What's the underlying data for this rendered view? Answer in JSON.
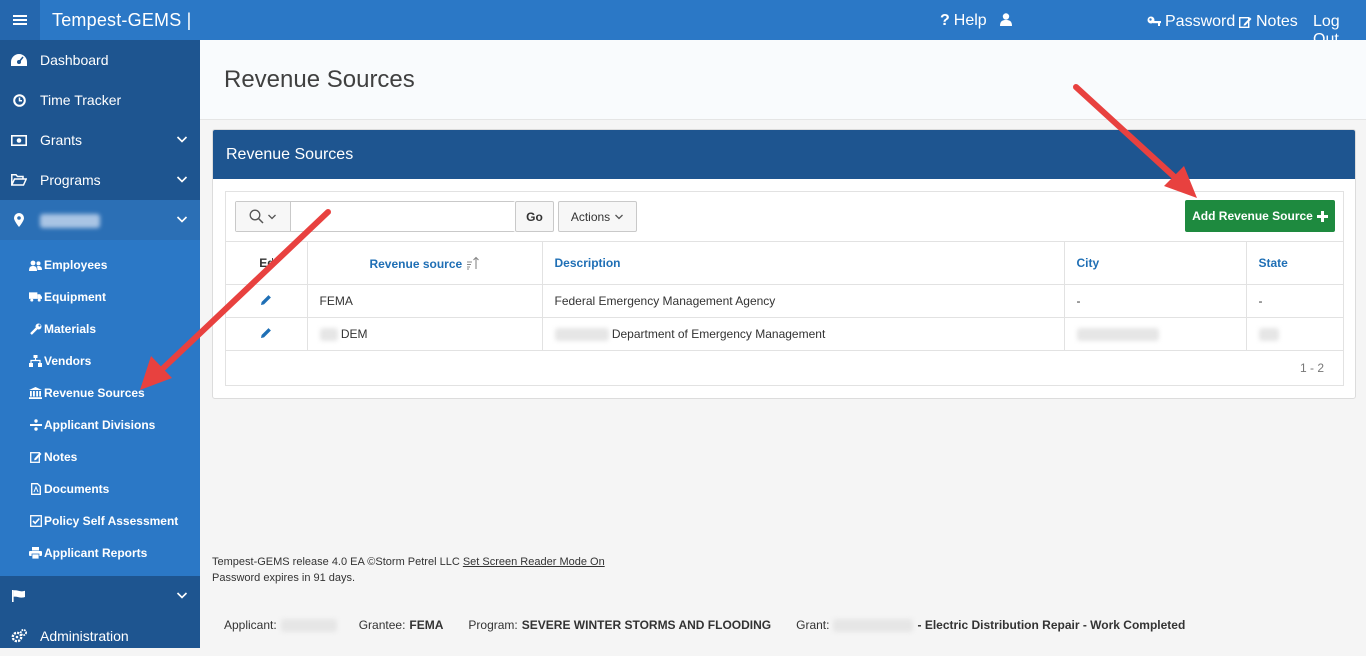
{
  "topbar": {
    "title": "Tempest-GEMS |",
    "help": "Help",
    "password": "Password",
    "notes": "Notes",
    "logout": "Log Out"
  },
  "sidebar": {
    "items": [
      {
        "label": "Dashboard",
        "icon": "dashboard-icon"
      },
      {
        "label": "Time Tracker",
        "icon": "clock-icon"
      },
      {
        "label": "Grants",
        "icon": "money-icon"
      },
      {
        "label": "Programs",
        "icon": "folder-open-icon"
      }
    ],
    "applicant_item_icon": "map-marker-icon",
    "submenu": [
      {
        "label": "Employees",
        "icon": "users-icon"
      },
      {
        "label": "Equipment",
        "icon": "truck-icon"
      },
      {
        "label": "Materials",
        "icon": "wrench-icon"
      },
      {
        "label": "Vendors",
        "icon": "sitemap-icon"
      },
      {
        "label": "Revenue Sources",
        "icon": "bank-icon"
      },
      {
        "label": "Applicant Divisions",
        "icon": "divide-icon"
      },
      {
        "label": "Notes",
        "icon": "edit-icon"
      },
      {
        "label": "Documents",
        "icon": "file-pdf-icon"
      },
      {
        "label": "Policy Self Assessment",
        "icon": "check-square-icon"
      },
      {
        "label": "Applicant Reports",
        "icon": "print-icon"
      }
    ],
    "flag_icon": "flag-icon",
    "administration": {
      "label": "Administration",
      "icon": "cogs-icon"
    }
  },
  "page": {
    "title": "Revenue Sources"
  },
  "region": {
    "title": "Revenue Sources",
    "go_label": "Go",
    "actions_label": "Actions",
    "add_button_label": "Add Revenue Source",
    "columns": [
      "Edit",
      "Revenue source",
      "Description",
      "City",
      "State"
    ],
    "rows": [
      {
        "source": "FEMA",
        "description": "Federal Emergency Management Agency",
        "city": "-",
        "state": "-"
      },
      {
        "source": "DEM",
        "description": "Department of Emergency Management",
        "city": "",
        "state": ""
      }
    ],
    "pagination": "1 - 2"
  },
  "footer": {
    "release": "Tempest-GEMS release 4.0 EA ©Storm Petrel LLC",
    "screen_reader_link": "Set Screen Reader Mode On",
    "password_expiry": "Password expires in 91 days."
  },
  "context": {
    "applicant_label": "Applicant:",
    "grantee_label": "Grantee:",
    "grantee_value": "FEMA",
    "program_label": "Program:",
    "program_value": "SEVERE WINTER STORMS AND FLOODING",
    "grant_label": "Grant:",
    "grant_value": "- Electric Distribution Repair - Work Completed"
  },
  "colors": {
    "topbar": "#2b78c6",
    "sidebar": "#1e5590",
    "submenu": "#2b78c6",
    "region_header": "#1e5590",
    "add_button": "#1e8a3f",
    "link_header": "#1f6fb5",
    "arrow": "#e8413f"
  }
}
